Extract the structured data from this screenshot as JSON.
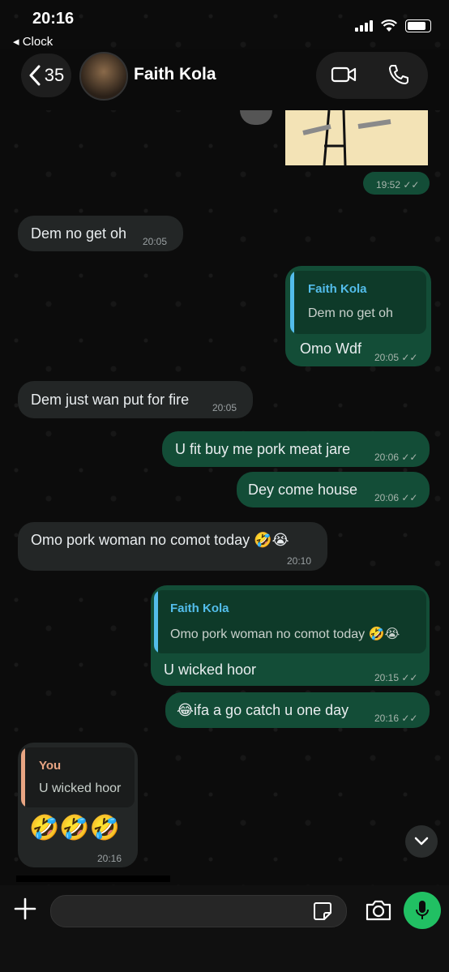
{
  "status_bar": {
    "time": "20:16",
    "back_app": "◂ Clock"
  },
  "header": {
    "back_count": "35",
    "contact_name": "Faith Kola"
  },
  "messages": [
    {
      "id": "m0",
      "dir": "out",
      "type": "image",
      "time": "19:52"
    },
    {
      "id": "m1",
      "dir": "in",
      "text": "Dem no get oh",
      "time": "20:05"
    },
    {
      "id": "m2",
      "dir": "out",
      "text": "Omo Wdf",
      "time": "20:05",
      "quote": {
        "name": "Faith Kola",
        "text": "Dem no get oh"
      }
    },
    {
      "id": "m3",
      "dir": "in",
      "text": "Dem just wan put for fire",
      "time": "20:05"
    },
    {
      "id": "m4",
      "dir": "out",
      "text": "U fit buy me pork meat jare",
      "time": "20:06"
    },
    {
      "id": "m5",
      "dir": "out",
      "text": "Dey come house",
      "time": "20:06"
    },
    {
      "id": "m6",
      "dir": "in",
      "text": "Omo pork woman no comot today 🤣😭",
      "time": "20:10"
    },
    {
      "id": "m7",
      "dir": "out",
      "text": "U wicked hoor",
      "time": "20:15",
      "quote": {
        "name": "Faith Kola",
        "text": "Omo pork woman no comot today 🤣😭"
      }
    },
    {
      "id": "m8",
      "dir": "out",
      "text": "😂ifa a go catch u one day",
      "time": "20:16"
    },
    {
      "id": "m9",
      "dir": "in",
      "text": "🤣🤣🤣",
      "time": "20:16",
      "quote": {
        "name": "You",
        "text": "U wicked hoor"
      }
    }
  ],
  "input": {
    "placeholder": ""
  },
  "colors": {
    "outgoing": "#134d37",
    "incoming": "#232626",
    "accent": "#21c063",
    "quote_contact": "#53bdeb",
    "quote_you": "#e8a583"
  }
}
